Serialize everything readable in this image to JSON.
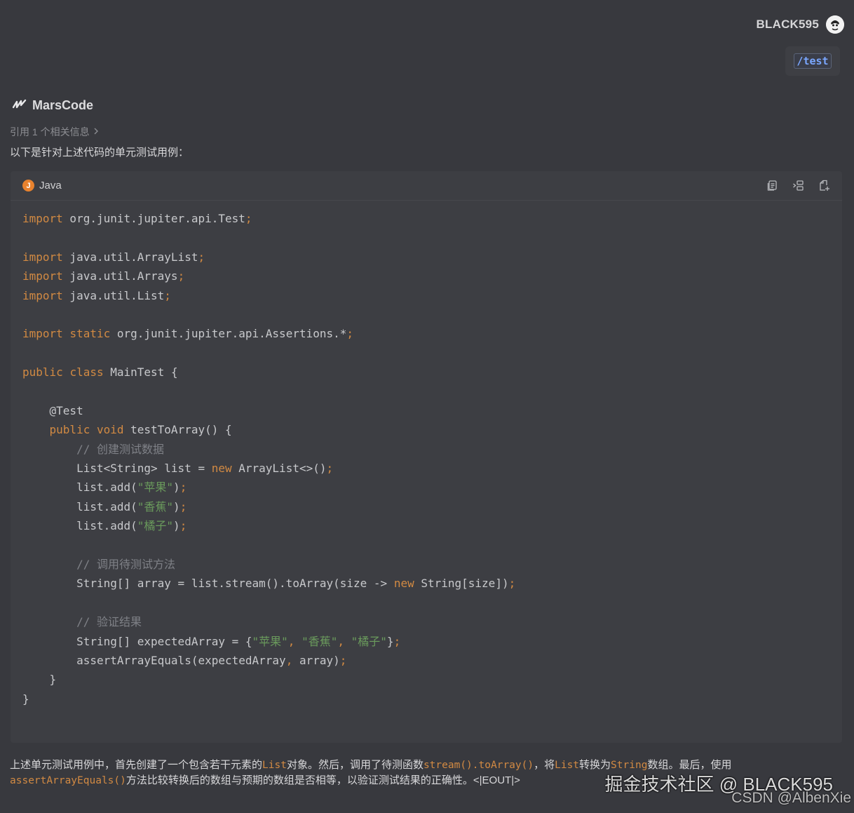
{
  "user": {
    "name": "BLACK595",
    "command": "/test"
  },
  "assistant": {
    "name": "MarsCode",
    "reference": "引用 1 个相关信息",
    "intro": "以下是针对上述代码的单元测试用例："
  },
  "code_block": {
    "language": "Java",
    "tools": [
      "copy-icon",
      "insert-icon",
      "new-file-icon"
    ],
    "lines": [
      "import org.junit.jupiter.api.Test;",
      "",
      "import java.util.ArrayList;",
      "import java.util.Arrays;",
      "import java.util.List;",
      "",
      "import static org.junit.jupiter.api.Assertions.*;",
      "",
      "public class MainTest {",
      "",
      "    @Test",
      "    public void testToArray() {",
      "        // 创建测试数据",
      "        List<String> list = new ArrayList<>();",
      "        list.add(\"苹果\");",
      "        list.add(\"香蕉\");",
      "        list.add(\"橘子\");",
      "",
      "        // 调用待测试方法",
      "        String[] array = list.stream().toArray(size -> new String[size]);",
      "",
      "        // 验证结果",
      "        String[] expectedArray = {\"苹果\", \"香蕉\", \"橘子\"};",
      "        assertArrayEquals(expectedArray, array);",
      "    }",
      "}"
    ]
  },
  "summary": {
    "p1": "上述单元测试用例中，首先创建了一个包含若干元素的",
    "c1": "List",
    "p2": "对象。然后，调用了待测函数",
    "c2": "stream().toArray()",
    "p3": "，将",
    "c3": "List",
    "p4": "转换为",
    "c4": "String",
    "p5": "数组。最后，使用",
    "c5": "assertArrayEquals()",
    "p6": "方法比较转换后的数组与预期的数组是否相等，以验证测试结果的正确性。<|EOUT|>"
  },
  "watermarks": {
    "primary": "掘金技术社区 @ BLACK595",
    "secondary": "CSDN @AlbenXie"
  }
}
